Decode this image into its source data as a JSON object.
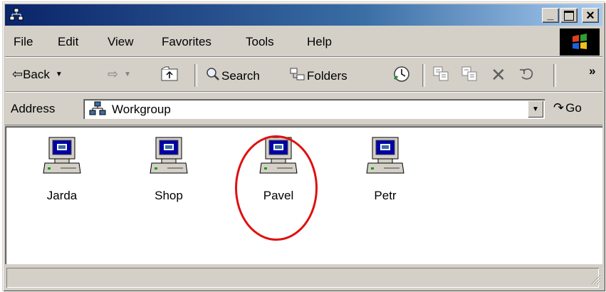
{
  "title_bar": {
    "title": "",
    "minimize_glyph": "_",
    "maximize_glyph": "□",
    "close_glyph": "×",
    "gradient_start": "#0a246a",
    "gradient_end": "#a6caf0"
  },
  "menu": {
    "items": [
      "File",
      "Edit",
      "View",
      "Favorites",
      "Tools",
      "Help"
    ]
  },
  "toolbar": {
    "back_label": "Back",
    "search_label": "Search",
    "folders_label": "Folders",
    "overflow_glyph": "»"
  },
  "address": {
    "label": "Address",
    "value": "Workgroup",
    "go_label": "Go"
  },
  "computers": [
    {
      "name": "Jarda",
      "highlighted": false
    },
    {
      "name": "Shop",
      "highlighted": false
    },
    {
      "name": "Pavel",
      "highlighted": true
    },
    {
      "name": "Petr",
      "highlighted": false
    }
  ],
  "highlight_color": "#e01010",
  "status_bar": {
    "text": ""
  }
}
